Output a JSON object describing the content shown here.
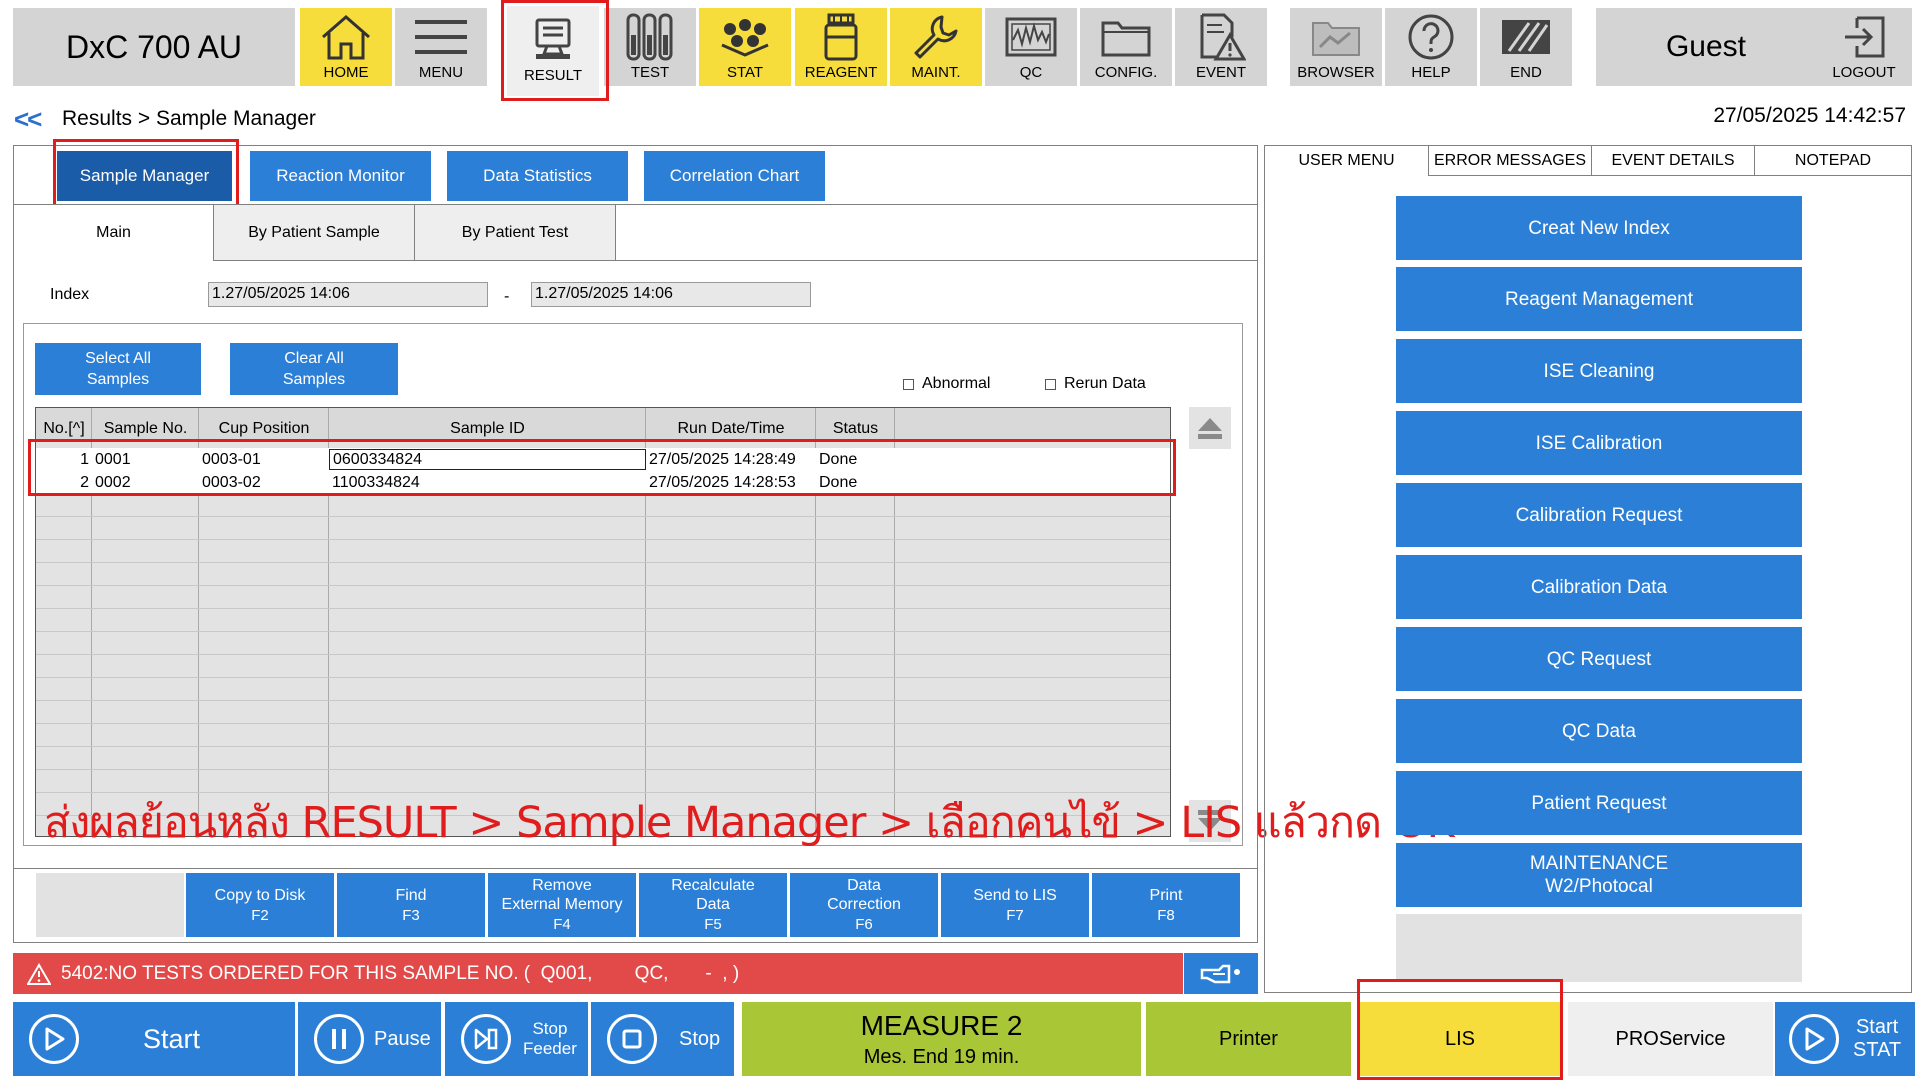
{
  "app": {
    "title": "DxC 700 AU",
    "user": "Guest",
    "datetime": "27/05/2025 14:42:57"
  },
  "toolbar": [
    {
      "id": "home",
      "label": "HOME",
      "icon": "home-icon"
    },
    {
      "id": "menu",
      "label": "MENU",
      "icon": "menu-icon"
    },
    {
      "id": "result",
      "label": "RESULT",
      "icon": "monitor-icon"
    },
    {
      "id": "test",
      "label": "TEST",
      "icon": "test-tubes-icon"
    },
    {
      "id": "stat",
      "label": "STAT",
      "icon": "sample-rack-icon"
    },
    {
      "id": "reagent",
      "label": "REAGENT",
      "icon": "reagent-bottle-icon"
    },
    {
      "id": "maint",
      "label": "MAINT.",
      "icon": "wrench-icon"
    },
    {
      "id": "qc",
      "label": "QC",
      "icon": "qc-chart-icon"
    },
    {
      "id": "config",
      "label": "CONFIG.",
      "icon": "folder-icon"
    },
    {
      "id": "event",
      "label": "EVENT",
      "icon": "warning-document-icon"
    },
    {
      "id": "browser",
      "label": "BROWSER",
      "icon": "browser-icon"
    },
    {
      "id": "help",
      "label": "HELP",
      "icon": "help-icon"
    },
    {
      "id": "end",
      "label": "END",
      "icon": "end-icon"
    }
  ],
  "logout": {
    "label": "LOGOUT",
    "icon": "logout-icon"
  },
  "breadcrumb": {
    "back": "<<",
    "path": "Results > Sample Manager"
  },
  "main_tabs": [
    "Sample Manager",
    "Reaction Monitor",
    "Data Statistics",
    "Correlation Chart"
  ],
  "sub_tabs": [
    "Main",
    "By Patient Sample",
    "By Patient Test"
  ],
  "index": {
    "label": "Index",
    "from": "1.27/05/2025 14:06",
    "sep": "-",
    "to": "1.27/05/2025 14:06"
  },
  "select_all": [
    "Select All",
    "Samples"
  ],
  "clear_all": [
    "Clear All",
    "Samples"
  ],
  "checks": {
    "abnormal": "Abnormal",
    "rerun": "Rerun Data"
  },
  "table": {
    "headers": [
      "No.[^]",
      "Sample No.",
      "Cup Position",
      "Sample ID",
      "Run Date/Time",
      "Status"
    ],
    "rows": [
      [
        "1",
        "0001",
        "0003-01",
        "0600334824",
        "27/05/2025 14:28:49",
        "Done"
      ],
      [
        "2",
        "0002",
        "0003-02",
        "1100334824",
        "27/05/2025 14:28:53",
        "Done"
      ]
    ]
  },
  "overlay_text": "ส่งผลย้อนหลัง RESULT > Sample Manager > เลือกคนไข้ > LIS แล้วกด OK",
  "function_keys": [
    {
      "label": [
        "Copy to Disk"
      ],
      "key": "F2"
    },
    {
      "label": [
        "Find"
      ],
      "key": "F3"
    },
    {
      "label": [
        "Remove",
        "External Memory"
      ],
      "key": "F4"
    },
    {
      "label": [
        "Recalculate",
        "Data"
      ],
      "key": "F5"
    },
    {
      "label": [
        "Data",
        "Correction"
      ],
      "key": "F6"
    },
    {
      "label": [
        "Send to LIS"
      ],
      "key": "F7"
    },
    {
      "label": [
        "Print"
      ],
      "key": "F8"
    }
  ],
  "alert": {
    "text": "5402:NO TESTS ORDERED FOR THIS SAMPLE NO. (  Q001,        QC,       -  , )"
  },
  "right_tabs": [
    "USER MENU",
    "ERROR MESSAGES",
    "EVENT DETAILS",
    "NOTEPAD"
  ],
  "user_menu": [
    [
      "Creat New Index"
    ],
    [
      "Reagent Management"
    ],
    [
      "ISE Cleaning"
    ],
    [
      "ISE Calibration"
    ],
    [
      "Calibration Request"
    ],
    [
      "Calibration Data"
    ],
    [
      "QC Request"
    ],
    [
      "QC Data"
    ],
    [
      "Patient Request"
    ],
    [
      "MAINTENANCE",
      "W2/Photocal"
    ]
  ],
  "bottom": {
    "start": "Start",
    "pause": "Pause",
    "stop_feeder": [
      "Stop",
      "Feeder"
    ],
    "stop": "Stop",
    "measure_title": "MEASURE 2",
    "measure_sub": "Mes. End 19 min.",
    "printer": "Printer",
    "lis": "LIS",
    "proservice": "PROService",
    "start_stat": [
      "Start",
      "STAT"
    ]
  },
  "colors": {
    "blue": "#2b7fd6",
    "yellow": "#f6dd3c",
    "green": "#a9c637",
    "alert_red": "#e24a4a",
    "highlight_red": "#e01c1c"
  }
}
